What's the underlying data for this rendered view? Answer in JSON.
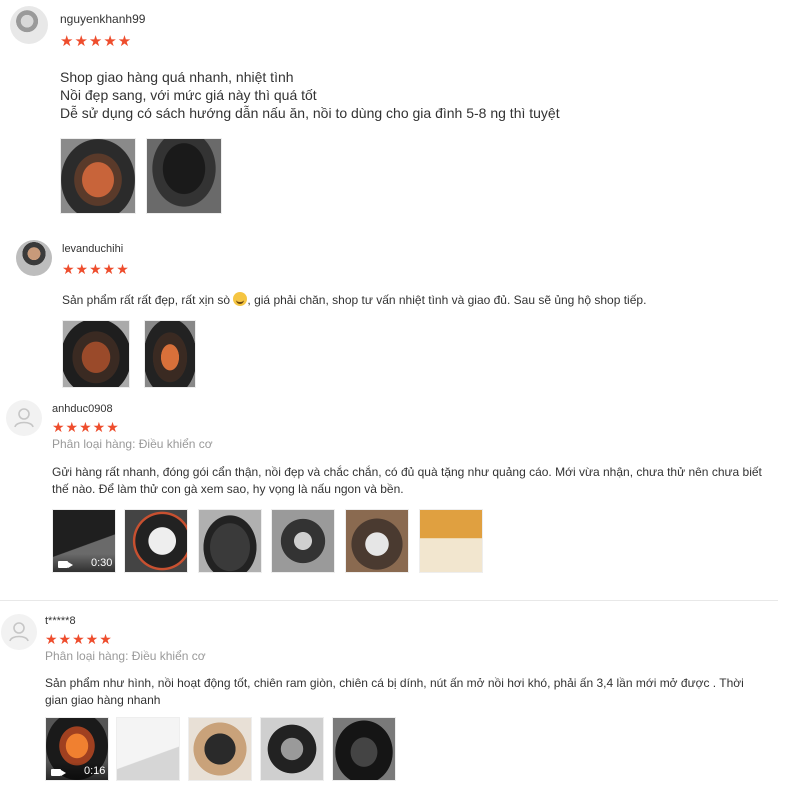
{
  "reviews": [
    {
      "username": "nguyenkhanh99",
      "stars": "★★★★★",
      "lines": [
        "Shop giao hàng quá nhanh, nhiệt tình",
        "Nồi đẹp sang, với mức giá này thì quá tốt",
        "Dễ sử dụng có sách hướng dẫn nấu ăn, nồi to dùng cho gia đình 5-8 ng thì tuyệt"
      ]
    },
    {
      "username": "levanduchihi",
      "stars": "★★★★★",
      "text_before_emoji": "Sản phẩm rất rất đẹp, rất xịn sò ",
      "emoji": "grinning-face-emoji",
      "text_after_emoji": ", giá phải chăn, shop tư vấn nhiệt tình và giao đủ. Sau sẽ ủng hộ shop tiếp."
    },
    {
      "username": "anhduc0908",
      "stars": "★★★★★",
      "variant": "Phân loại hàng: Điều khiển cơ",
      "lines": [
        "Gửi hàng rất nhanh, đóng gói cẩn thận, nồi đẹp và chắc chắn, có đủ quà tặng như quảng cáo. Mới vừa nhận, chưa thử nên chưa biết",
        "thế nào. Để làm thử con gà xem sao, hy vọng là nấu ngon và bền."
      ],
      "video_duration": "0:30"
    },
    {
      "username": "t*****8",
      "stars": "★★★★★",
      "variant": "Phân loại hàng: Điều khiển cơ",
      "lines": [
        "Sản phẩm như hình, nồi hoạt động tốt, chiên ram giòn, chiên cá bị dính, nút ấn mở nồi hơi khó, phải ấn 3,4 lần mới mở được . Thời",
        "gian giao hàng nhanh"
      ],
      "video_duration": "0:16"
    }
  ],
  "colors": {
    "star": "#ee4d2d",
    "variant_text": "#999999",
    "body_text": "#333333"
  }
}
